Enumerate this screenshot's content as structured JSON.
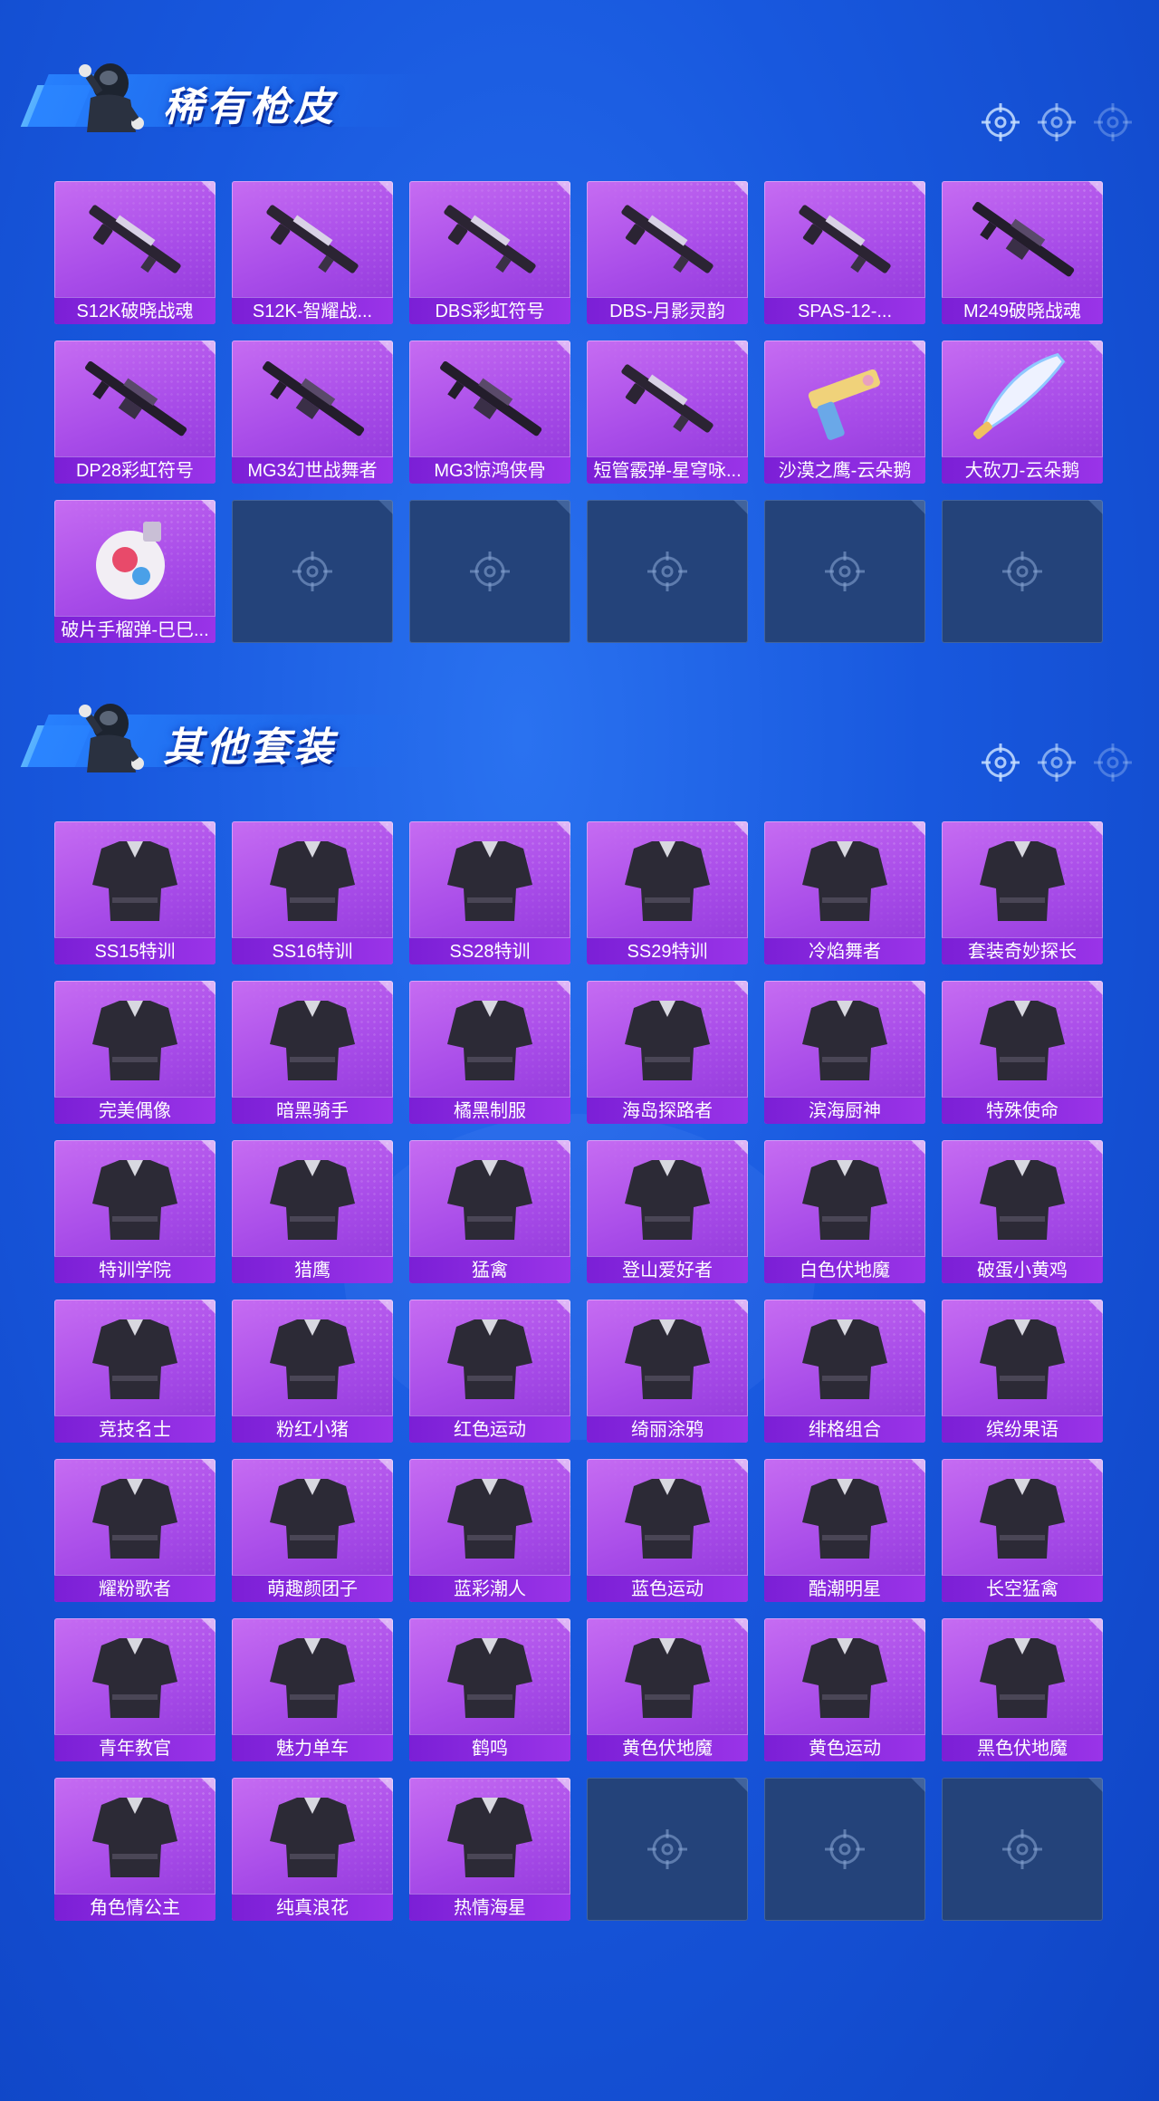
{
  "sections": [
    {
      "title": "稀有枪皮",
      "items": [
        {
          "label": "S12K破晓战魂",
          "icon": "shotgun-icon"
        },
        {
          "label": "S12K-智耀战...",
          "icon": "shotgun-icon"
        },
        {
          "label": "DBS彩虹符号",
          "icon": "shotgun-icon"
        },
        {
          "label": "DBS-月影灵韵",
          "icon": "shotgun-icon"
        },
        {
          "label": "SPAS-12-...",
          "icon": "shotgun-icon"
        },
        {
          "label": "M249破晓战魂",
          "icon": "machine-gun-icon"
        },
        {
          "label": "DP28彩虹符号",
          "icon": "machine-gun-icon"
        },
        {
          "label": "MG3幻世战舞者",
          "icon": "machine-gun-icon"
        },
        {
          "label": "MG3惊鸿侠骨",
          "icon": "machine-gun-icon"
        },
        {
          "label": "短管霰弹-星穹咏...",
          "icon": "shotgun-icon"
        },
        {
          "label": "沙漠之鹰-云朵鹅",
          "icon": "pistol-icon"
        },
        {
          "label": "大砍刀-云朵鹅",
          "icon": "machete-icon"
        },
        {
          "label": "破片手榴弹-巳巳...",
          "icon": "grenade-icon"
        }
      ],
      "empty_slots": 5
    },
    {
      "title": "其他套装",
      "items": [
        {
          "label": "SS15特训",
          "icon": "outfit-icon"
        },
        {
          "label": "SS16特训",
          "icon": "outfit-icon"
        },
        {
          "label": "SS28特训",
          "icon": "outfit-icon"
        },
        {
          "label": "SS29特训",
          "icon": "outfit-icon"
        },
        {
          "label": "冷焰舞者",
          "icon": "outfit-icon"
        },
        {
          "label": "套装奇妙探长",
          "icon": "outfit-icon"
        },
        {
          "label": "完美偶像",
          "icon": "outfit-icon"
        },
        {
          "label": "暗黑骑手",
          "icon": "outfit-icon"
        },
        {
          "label": "橘黑制服",
          "icon": "outfit-icon"
        },
        {
          "label": "海岛探路者",
          "icon": "outfit-icon"
        },
        {
          "label": "滨海厨神",
          "icon": "outfit-icon"
        },
        {
          "label": "特殊使命",
          "icon": "outfit-icon"
        },
        {
          "label": "特训学院",
          "icon": "outfit-icon"
        },
        {
          "label": "猎鹰",
          "icon": "outfit-icon"
        },
        {
          "label": "猛禽",
          "icon": "outfit-icon"
        },
        {
          "label": "登山爱好者",
          "icon": "outfit-icon"
        },
        {
          "label": "白色伏地魔",
          "icon": "outfit-icon"
        },
        {
          "label": "破蛋小黄鸡",
          "icon": "outfit-icon"
        },
        {
          "label": "竞技名士",
          "icon": "outfit-icon"
        },
        {
          "label": "粉红小猪",
          "icon": "outfit-icon"
        },
        {
          "label": "红色运动",
          "icon": "outfit-icon"
        },
        {
          "label": "绮丽涂鸦",
          "icon": "outfit-icon"
        },
        {
          "label": "绯格组合",
          "icon": "outfit-icon"
        },
        {
          "label": "缤纷果语",
          "icon": "outfit-icon"
        },
        {
          "label": "耀粉歌者",
          "icon": "outfit-icon"
        },
        {
          "label": "萌趣颜团子",
          "icon": "outfit-icon"
        },
        {
          "label": "蓝彩潮人",
          "icon": "outfit-icon"
        },
        {
          "label": "蓝色运动",
          "icon": "outfit-icon"
        },
        {
          "label": "酷潮明星",
          "icon": "outfit-icon"
        },
        {
          "label": "长空猛禽",
          "icon": "outfit-icon"
        },
        {
          "label": "青年教官",
          "icon": "outfit-icon"
        },
        {
          "label": "魅力单车",
          "icon": "outfit-icon"
        },
        {
          "label": "鹤鸣",
          "icon": "outfit-icon"
        },
        {
          "label": "黄色伏地魔",
          "icon": "outfit-icon"
        },
        {
          "label": "黄色运动",
          "icon": "outfit-icon"
        },
        {
          "label": "黑色伏地魔",
          "icon": "outfit-icon"
        },
        {
          "label": "角色情公主",
          "icon": "outfit-icon"
        },
        {
          "label": "纯真浪花",
          "icon": "outfit-icon"
        },
        {
          "label": "热情海星",
          "icon": "outfit-icon"
        }
      ],
      "empty_slots": 3
    }
  ],
  "colors": {
    "background": "#1858de",
    "card": "#a74be8",
    "label_bar": "#7b1fd6",
    "empty_card": "#24437a"
  }
}
